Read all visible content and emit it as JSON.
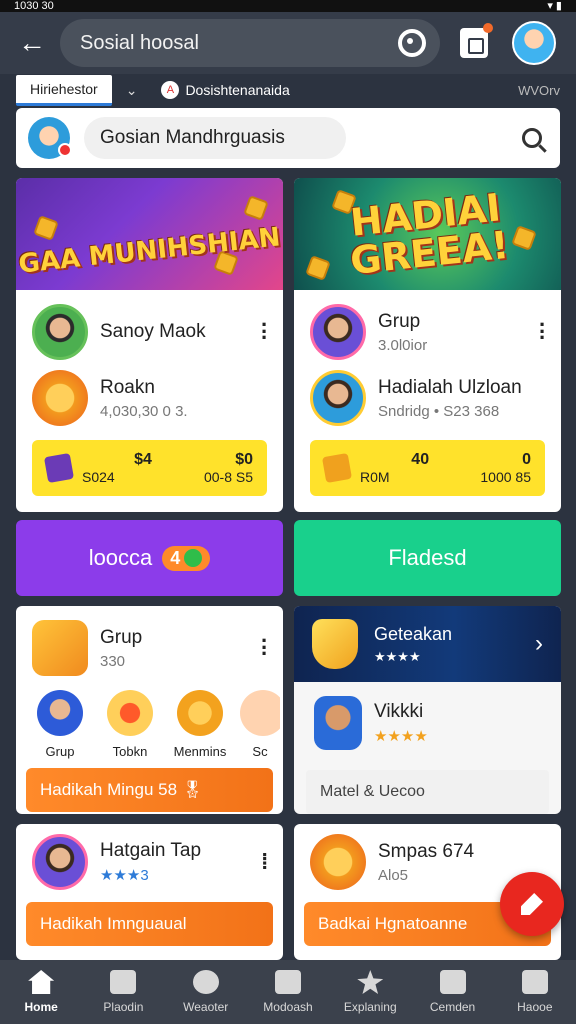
{
  "status_bar": {
    "left": "1030 30",
    "right": ""
  },
  "app_bar": {
    "back": "←",
    "search_text": "Sosial hoosal"
  },
  "tabs": {
    "active": "Hiriehestor",
    "chevron": "⌄",
    "second": "Dosishtenanaida",
    "second_icon": "A",
    "right": "WVOrv"
  },
  "search_card": {
    "placeholder": "Gosian Mandhrguasis"
  },
  "banners": {
    "left": "GAA MUNIHSHIAN",
    "right": "HADIAI GREEA!"
  },
  "card_left_top": {
    "row1": {
      "title": "Sanoy Maok"
    },
    "row2": {
      "title": "Roakn",
      "sub": "4,030,30 0 3."
    },
    "stat": {
      "top_mid": "$4",
      "bottom_left": "S024",
      "top_right": "$0",
      "bottom_right": "00-8 S5"
    }
  },
  "card_right_top": {
    "row1": {
      "title": "Grup",
      "sub": "3.0l0ior"
    },
    "row2": {
      "title": "Hadialah Ulzloan",
      "sub": "Sndridg • S23 368"
    },
    "stat": {
      "top_mid": "40",
      "bottom_left": "R0M",
      "top_right": "0",
      "bottom_right": "1000 85"
    }
  },
  "buttons": {
    "purple": "loocca",
    "purple_badge": "4",
    "green": "Fladesd"
  },
  "card_left_mid": {
    "title": "Grup",
    "sub": "330",
    "items": [
      "Grup",
      "Tobkn",
      "Menmins",
      "Sc"
    ],
    "bar": "Hadikah Mingu 58 🎖"
  },
  "card_right_mid": {
    "banner_title": "Geteakan",
    "banner_stars": "★★★★",
    "user": "Vikkki",
    "user_stars": "★★★★",
    "field": "Matel & Uecoo"
  },
  "card_left_bottom": {
    "title": "Hatgain Tap",
    "sub": "★★★3",
    "bar": "Hadikah Imnguaual"
  },
  "card_right_bottom": {
    "title": "Smpas 674",
    "sub": "Alo5",
    "bar": "Badkai Hgnatoanne"
  },
  "bottom_nav": [
    "Home",
    "Plaodin",
    "Weaoter",
    "Modoash",
    "Explaning",
    "Cemden",
    "Haooe"
  ],
  "colors": {
    "purple": "#8c3cea",
    "green": "#19d08c",
    "yellow": "#ffe22b",
    "orange": "#f27218",
    "fab": "#e8271f"
  }
}
